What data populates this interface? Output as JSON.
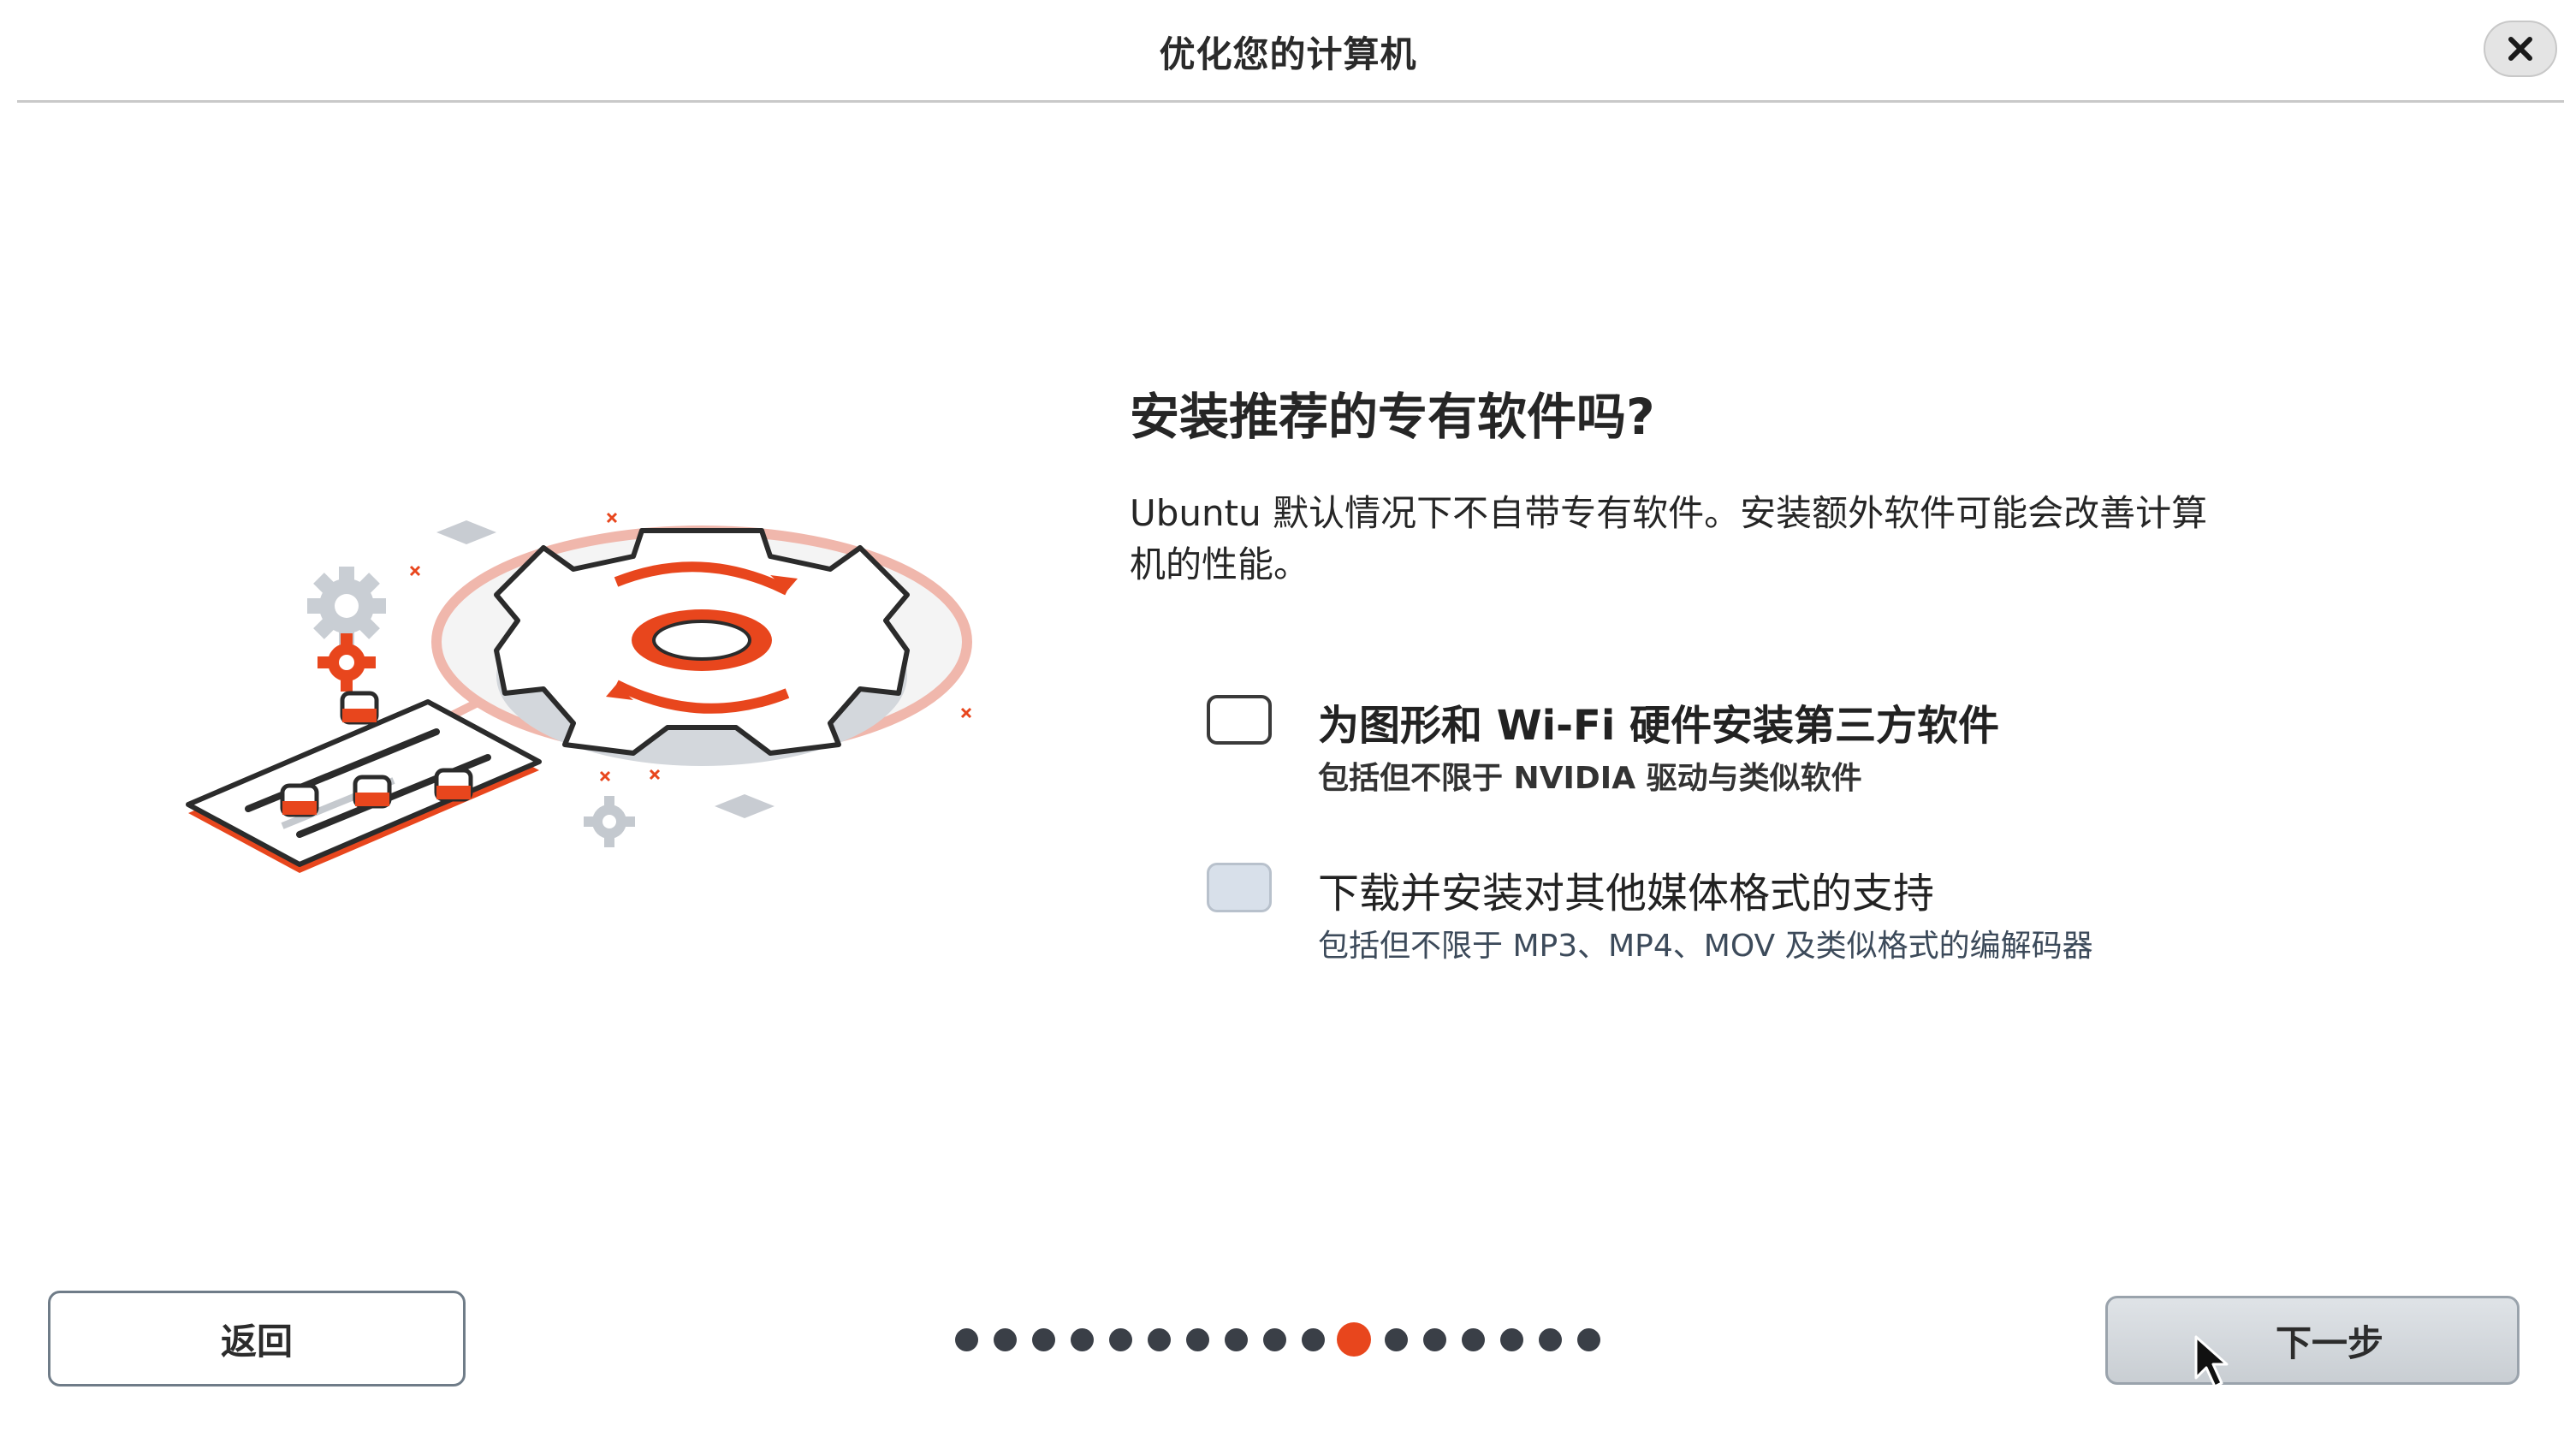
{
  "window": {
    "title": "优化您的计算机",
    "close_glyph": "✕"
  },
  "main": {
    "heading": "安装推荐的专有软件吗?",
    "description": "Ubuntu 默认情况下不自带专有软件。安装额外软件可能会改善计算机的性能。",
    "options": [
      {
        "label": "为图形和 Wi-Fi 硬件安装第三方软件",
        "sub": "包括但不限于 NVIDIA 驱动与类似软件",
        "checked": false
      },
      {
        "label": "下载并安装对其他媒体格式的支持",
        "sub": "包括但不限于 MP3、MP4、MOV 及类似格式的编解码器",
        "checked": false
      }
    ]
  },
  "footer": {
    "back_label": "返回",
    "next_label": "下一步",
    "steps_total": 17,
    "steps_current": 11
  },
  "colors": {
    "accent": "#e8461d",
    "dot": "#3a3f47",
    "checkbox_disabled": "#d8e0ea"
  },
  "icons": [
    "close-icon",
    "settings-illustration",
    "mouse-pointer-icon"
  ]
}
